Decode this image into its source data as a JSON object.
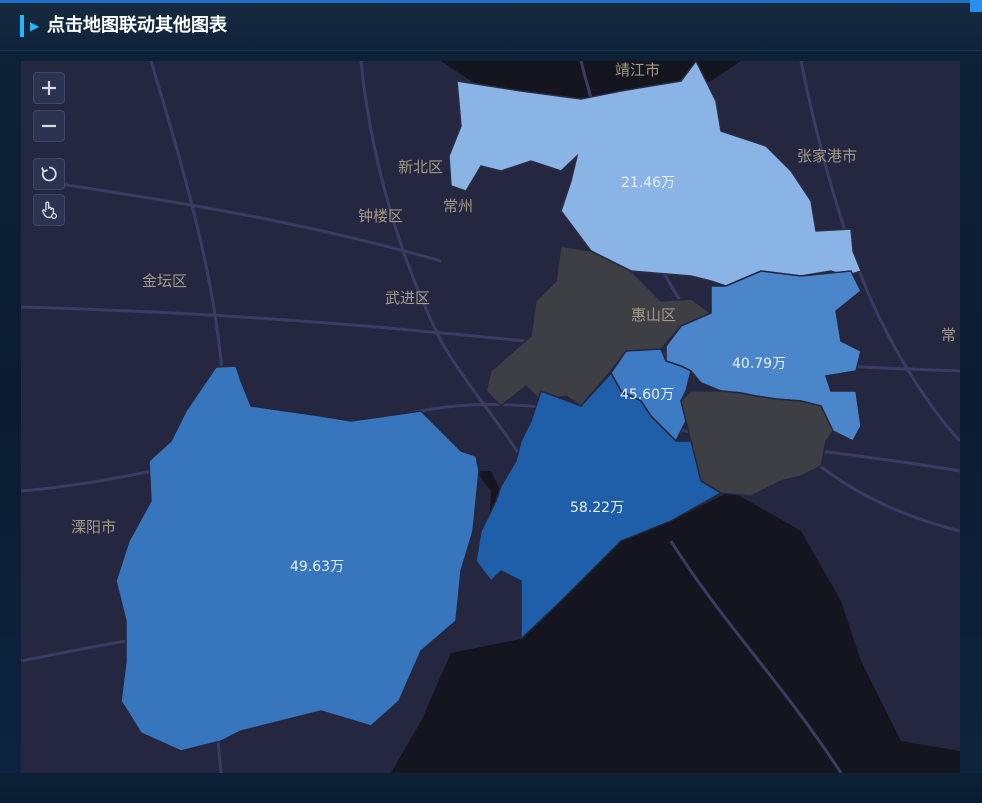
{
  "header": {
    "title": "点击地图联动其他图表"
  },
  "colors": {
    "accent": "#21b8ff",
    "map_background": "#25263f",
    "water": "#14151f",
    "road": "#3a3d63",
    "region_empty": "#3e3f45",
    "scale": [
      "#8ab4e6",
      "#4a86c9",
      "#3d7cc4",
      "#3776bd",
      "#1f5ea8"
    ]
  },
  "map": {
    "tools": [
      {
        "name": "zoom-in",
        "icon": "plus-icon"
      },
      {
        "name": "zoom-out",
        "icon": "minus-icon"
      },
      {
        "name": "reset",
        "icon": "refresh-icon"
      },
      {
        "name": "select",
        "icon": "hand-pointer-icon"
      }
    ],
    "place_labels": {
      "jingjiang": "靖江市",
      "zhangjiagang": "张家港市",
      "xinbei": "新北区",
      "changzhou": "常州",
      "zhonglou": "钟楼区",
      "jintan": "金坛区",
      "wujin": "武进区",
      "huishan": "惠山区",
      "liyang": "溧阳市",
      "chang_edge": "常"
    },
    "regions": [
      {
        "id": "north",
        "label": "21.46万",
        "value": 21.46
      },
      {
        "id": "east",
        "label": "40.79万",
        "value": 40.79
      },
      {
        "id": "middle",
        "label": "45.60万",
        "value": 45.6
      },
      {
        "id": "south-central",
        "label": "58.22万",
        "value": 58.22
      },
      {
        "id": "southwest",
        "label": "49.63万",
        "value": 49.63
      }
    ]
  }
}
